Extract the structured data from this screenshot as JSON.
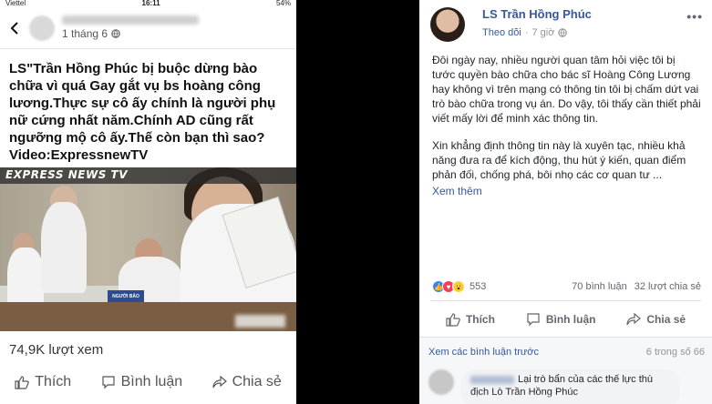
{
  "phone": {
    "status": {
      "carrier": "Viettel",
      "time": "16:11",
      "battery": "54%"
    },
    "post_time": "1 tháng 6",
    "caption": "LS\"Trần Hồng Phúc  bị buộc dừng bào chữa vì quá Gay gắt vụ bs hoàng công lương.Thực sự cô ấy chính là người phụ nữ cứng nhất năm.Chính AD cũng rất ngưỡng mộ cô ấy.Thế còn bạn thì sao? Video:ExpressnewTV",
    "video": {
      "banner": "EXPRESS NEWS TV",
      "nameplate": "NGƯỜI BÀO CHỮA"
    },
    "views": "74,9K lượt xem",
    "actions": {
      "like": "Thích",
      "comment": "Bình luận",
      "share": "Chia sẻ"
    }
  },
  "fb": {
    "author": "LS Trần Hồng Phúc",
    "follow": "Theo dõi",
    "time": "7 giờ",
    "paragraphs": [
      "Đôi ngày nay, nhiều người quan tâm hỏi việc tôi bị tước quyền bào chữa cho bác sĩ Hoàng Công Lương hay không vì trên mạng có thông tin tôi bị chấm dứt vai trò bào chữa trong vụ án. Do vậy, tôi thấy cần thiết phải viết mấy lời để minh xác thông tin.",
      "Xin khẳng định thông tin này là xuyên tạc, nhiều khả năng đưa ra để kích động, thu hút ý kiến, quan điểm phản đối, chống phá, bôi nhọ các cơ quan tư ..."
    ],
    "see_more": "Xem thêm",
    "reaction_count": "553",
    "comments_count": "70 bình luận",
    "shares_count": "32 lượt chia sẻ",
    "actions": {
      "like": "Thích",
      "comment": "Bình luận",
      "share": "Chia sẻ"
    },
    "prev_comments": "Xem các bình luận trước",
    "pager": "6 trong số 66",
    "comment_text": "Lại trò bẩn của các thế lực thù địch Lò Trần Hồng Phúc"
  },
  "colors": {
    "fb_blue": "#365899",
    "muted": "#90949c",
    "like_blue": "#4080ff"
  },
  "icons": [
    "back-icon",
    "globe-icon",
    "more-icon",
    "thumbs-up-icon",
    "comment-icon",
    "share-icon"
  ]
}
